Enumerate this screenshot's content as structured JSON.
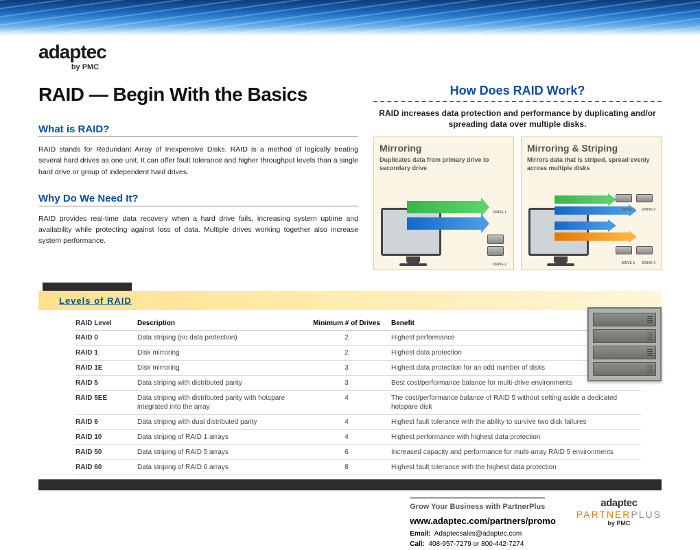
{
  "brand": {
    "name": "adaptec",
    "byline": "by PMC"
  },
  "title": "RAID — Begin With the Basics",
  "sections": {
    "what_h": "What is RAID?",
    "what_body": "RAID stands for Redundant Array of Inexpensive Disks. RAID is a method of logically treating several hard drives as one unit. It can offer fault tolerance and higher throughput levels than a single hard drive or group of independent hard drives.",
    "why_h": "Why Do We Need It?",
    "why_body": "RAID provides real-time data recovery when a hard drive fails, increasing system uptime and availability while protecting against loss of data. Multiple drives working together also increase system performance."
  },
  "how": {
    "title": "How Does RAID Work?",
    "sub": "RAID increases data protection and performance by duplicating and/or spreading data over multiple disks.",
    "cards": [
      {
        "title": "Mirroring",
        "desc": "Duplicates data from primary drive to secondary drive"
      },
      {
        "title": "Mirroring & Striping",
        "desc": "Mirrors data that is striped, spread evenly across multiple disks"
      }
    ],
    "drive_labels": {
      "d1": "DRIVE 1",
      "d2": "DRIVE 2",
      "d3": "DRIVE 3",
      "d4": "DRIVE 4"
    }
  },
  "levels": {
    "heading": "Levels of RAID",
    "columns": {
      "level": "RAID Level",
      "desc": "Description",
      "min": "Minimum # of Drives",
      "benefit": "Benefit"
    },
    "rows": [
      {
        "level": "RAID 0",
        "desc": "Data striping (no data protection)",
        "min": "2",
        "benefit": "Highest performance"
      },
      {
        "level": "RAID 1",
        "desc": "Disk mirroring",
        "min": "2",
        "benefit": "Highest data protection"
      },
      {
        "level": "RAID 1E",
        "desc": "Disk mirroring",
        "min": "3",
        "benefit": "Highest data protection for an odd number of disks"
      },
      {
        "level": "RAID 5",
        "desc": "Data striping with distributed parity",
        "min": "3",
        "benefit": "Best cost/performance balance for multi-drive environments"
      },
      {
        "level": "RAID 5EE",
        "desc": "Data striping with distributed parity with hotspare integrated into the array",
        "min": "4",
        "benefit": "The cost/performance balance of RAID 5 without setting aside a dedicated hotspare disk"
      },
      {
        "level": "RAID 6",
        "desc": "Data striping with dual distributed parity",
        "min": "4",
        "benefit": "Highest fault tolerance with the ability to survive two disk failures"
      },
      {
        "level": "RAID 10",
        "desc": "Data striping of RAID 1 arrays",
        "min": "4",
        "benefit": "Highest performance with highest data protection"
      },
      {
        "level": "RAID 50",
        "desc": "Data striping of RAID 5 arrays",
        "min": "6",
        "benefit": "Increased capacity and performance for multi-array RAID 5 environments"
      },
      {
        "level": "RAID 60",
        "desc": "Data striping of RAID 6 arrays",
        "min": "8",
        "benefit": "Highest fault tolerance with the highest data protection"
      }
    ]
  },
  "footer": {
    "grow": "Grow Your Business with PartnerPlus",
    "url": "www.adaptec.com/partners/promo",
    "email_label": "Email:",
    "email": "Adaptecsales@adaptec.com",
    "call_label": "Call:",
    "call": "408-957-7279 or 800-442-7274",
    "logo_main": "adaptec",
    "logo_p": "PARTNER",
    "logo_plus": "PLUS",
    "logo_by": "by PMC"
  }
}
